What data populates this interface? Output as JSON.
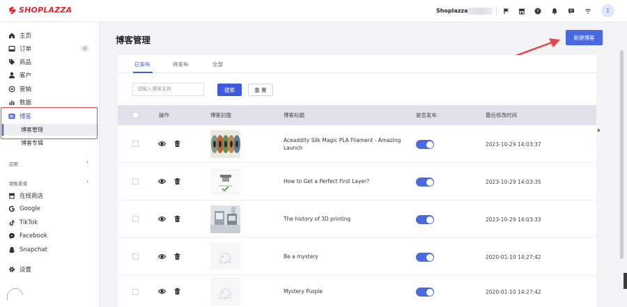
{
  "brand": {
    "name": "SHOPLAZZA",
    "color": "#e5242b"
  },
  "topbar": {
    "shop_name": "Shoplazza",
    "icons": [
      "flag-icon",
      "store-icon",
      "help-icon",
      "bell-icon",
      "message-icon",
      "wifi-icon"
    ],
    "avatar_letter": "1"
  },
  "sidebar": {
    "items": [
      {
        "label": "主页",
        "icon": "home-icon"
      },
      {
        "label": "订单",
        "icon": "order-icon",
        "badge": "0"
      },
      {
        "label": "商品",
        "icon": "tag-icon"
      },
      {
        "label": "客户",
        "icon": "user-icon"
      },
      {
        "label": "营销",
        "icon": "marketing-icon"
      },
      {
        "label": "数据",
        "icon": "chart-icon"
      },
      {
        "label": "博客",
        "icon": "blog-icon"
      }
    ],
    "blog_sub": [
      {
        "label": "博客管理",
        "active": true
      },
      {
        "label": "博客专辑",
        "active": false
      }
    ],
    "apps_label": "应用",
    "channels_label": "销售渠道",
    "channels": [
      {
        "label": "在线商店",
        "icon": "store-icon"
      },
      {
        "label": "Google",
        "icon": "google-icon"
      },
      {
        "label": "TikTok",
        "icon": "tiktok-icon"
      },
      {
        "label": "Facebook",
        "icon": "facebook-icon"
      },
      {
        "label": "Snapchat",
        "icon": "snapchat-icon"
      }
    ],
    "settings_label": "设置"
  },
  "main": {
    "title": "博客管理",
    "new_button": "新建博客",
    "tabs": [
      "已发布",
      "待发布",
      "全部"
    ],
    "active_tab": 0,
    "search": {
      "placeholder": "请输入博客名称",
      "button": "搜索",
      "reset": "重 置"
    },
    "columns": {
      "ops": "操作",
      "cover": "博客封面",
      "title": "博客标题",
      "published": "是否发布",
      "modified": "最后修改时间"
    },
    "rows": [
      {
        "title": "Aceaddity Silk Magic PLA Filament - Amazing Launch",
        "published": true,
        "modified": "2023-10-29 14:03:37",
        "cover": "filament-spools"
      },
      {
        "title": "How to Get a Perfect First Layer?",
        "published": true,
        "modified": "2023-10-29 14:03:35",
        "cover": "first-layer-diagram"
      },
      {
        "title": "The history of 3D printing",
        "published": true,
        "modified": "2023-10-29 14:03:33",
        "cover": "printer-photo"
      },
      {
        "title": "Be a mystery",
        "published": true,
        "modified": "2020-01-10 14:27:42",
        "cover": "placeholder"
      },
      {
        "title": "Mystery Purple",
        "published": true,
        "modified": "2020-01-10 14:27:42",
        "cover": "placeholder"
      }
    ]
  },
  "colors": {
    "accent": "#4a69e0",
    "highlight": "#e5454c",
    "header_row": "#dfe2ea"
  }
}
